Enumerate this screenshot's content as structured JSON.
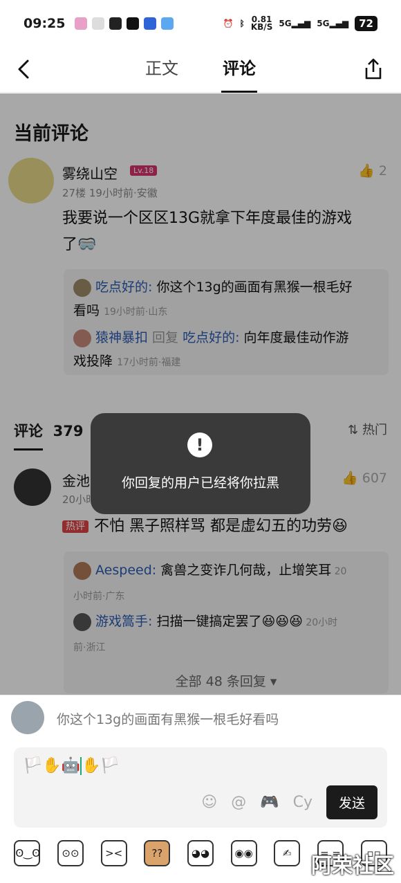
{
  "status_bar": {
    "time": "09:25",
    "net_speed": "0.81",
    "net_unit": "KB/S",
    "sig1": "5G",
    "sig2": "5G",
    "battery": "72"
  },
  "nav": {
    "tabs": [
      {
        "label": "正文"
      },
      {
        "label": "评论",
        "active": true
      }
    ]
  },
  "current_comment": {
    "heading": "当前评论",
    "user": "雾绕山空",
    "level": "Lv.18",
    "likes": "2",
    "meta": "27楼 19小时前·安徽",
    "text_line1": "我要说一个区区13G就拿下年度最佳的游戏",
    "text_line2": "了",
    "replies": [
      {
        "name": "吃点好的:",
        "text_a": " 你这个13g的画面有黑猴一根毛好",
        "text_b": "看吗",
        "meta": "19小时前·山东"
      },
      {
        "name": "猿神暴扣",
        "mid": " 回复 ",
        "target": "吃点好的:",
        "text_a": " 向年度最佳动作游",
        "text_b": "戏投降",
        "meta": "17小时前·福建"
      }
    ]
  },
  "comments_section": {
    "label": "评论",
    "count": "379",
    "sort": "热门"
  },
  "hot_comment": {
    "user": "金池会长",
    "meta": "20小时前·来知明的星球",
    "likes": "607",
    "tag": "热评",
    "text": "不怕 黑子照样骂 都是虚幻五的功劳",
    "replies": [
      {
        "name": "Aespeed:",
        "text_a": " 禽兽之变诈几何哉，止增笑耳",
        "meta_a": " 20",
        "meta_b": "小时前·广东"
      },
      {
        "name": "游戏篙手:",
        "text_a": " 扫描一键搞定罢了",
        "meta_a": " 20小时",
        "meta_b": "前·浙江"
      }
    ],
    "all_replies": "全部 48 条回复"
  },
  "toast": {
    "icon": "exclamation-icon",
    "message": "你回复的用户已经将你拉黑"
  },
  "composer": {
    "quote": "你这个13g的画面有黑猴一根毛好看吗",
    "input_value": "🏳️✋🤖",
    "input_value_after": "✋🏳️",
    "send": "发送",
    "tool_cy": "Cy",
    "tool_at": "@"
  },
  "watermark": "阿荣社区",
  "colors": {
    "overlay": "#000000",
    "toast_bg": "#3a3a3a",
    "level_badge": "#d6336c",
    "hot_badge": "#e04444",
    "reply_name": "#2b5bb3",
    "send_bg": "#1b1b1b"
  }
}
